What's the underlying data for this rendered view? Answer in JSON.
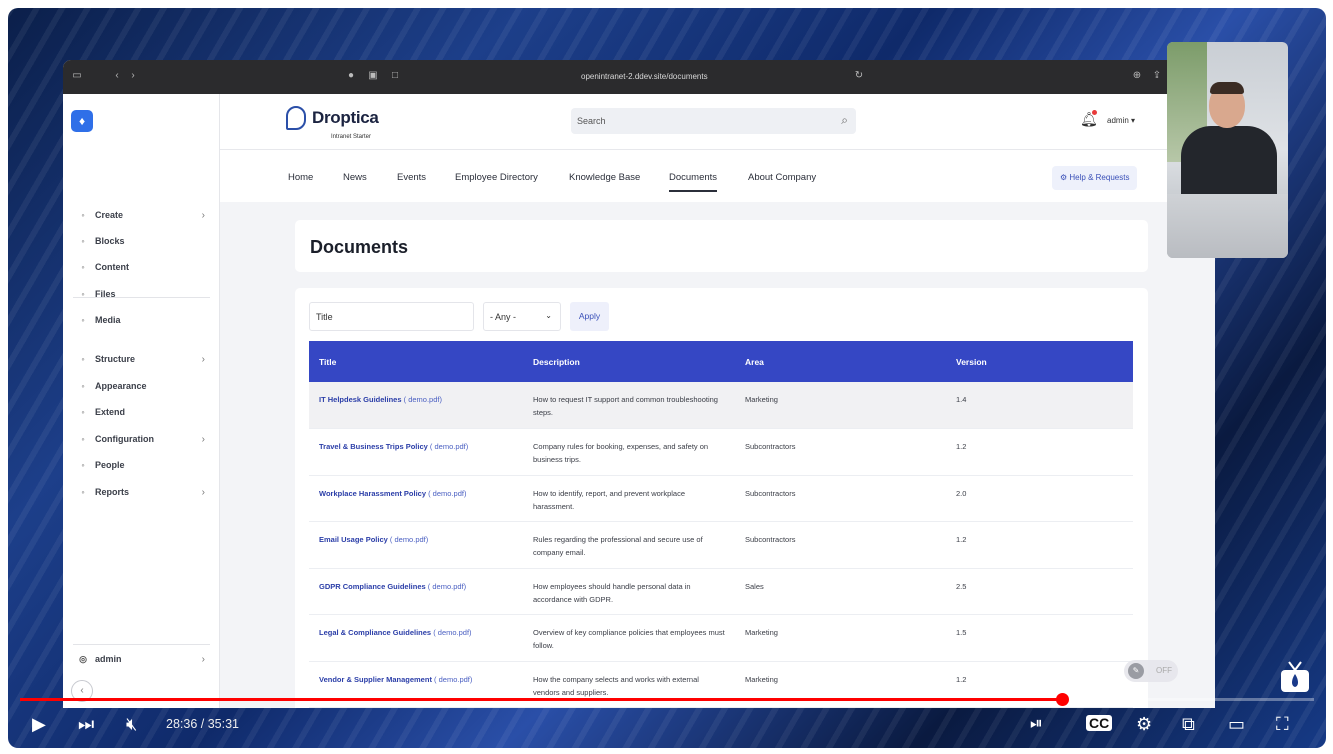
{
  "browser": {
    "url": "openintranet-2.ddev.site/documents"
  },
  "sidebar": {
    "items": [
      {
        "label": "Create",
        "icon": "plus-circle-icon",
        "chevron": true
      },
      {
        "label": "Blocks",
        "icon": "grid-icon",
        "chevron": false
      },
      {
        "label": "Content",
        "icon": "document-icon",
        "chevron": false
      },
      {
        "label": "Files",
        "icon": "file-icon",
        "chevron": false
      },
      {
        "label": "Media",
        "icon": "image-icon",
        "chevron": false
      },
      {
        "label": "Structure",
        "icon": "sitemap-icon",
        "chevron": true
      },
      {
        "label": "Appearance",
        "icon": "brush-icon",
        "chevron": false
      },
      {
        "label": "Extend",
        "icon": "puzzle-icon",
        "chevron": false
      },
      {
        "label": "Configuration",
        "icon": "sliders-icon",
        "chevron": true
      },
      {
        "label": "People",
        "icon": "people-icon",
        "chevron": false
      },
      {
        "label": "Reports",
        "icon": "gauge-icon",
        "chevron": true
      }
    ],
    "user": "admin"
  },
  "header": {
    "brand_name": "Droptica",
    "brand_sub": "Intranet Starter",
    "search_placeholder": "Search",
    "user": "admin"
  },
  "nav": {
    "items": [
      "Home",
      "News",
      "Events",
      "Employee Directory",
      "Knowledge Base",
      "Documents",
      "About Company"
    ],
    "active": "Documents",
    "help_button": "Help & Requests"
  },
  "page": {
    "title": "Documents",
    "filter_title_placeholder": "Title",
    "filter_area_value": "- Any -",
    "apply_label": "Apply"
  },
  "table": {
    "headers": [
      "Title",
      "Description",
      "Area",
      "Version"
    ],
    "rows": [
      {
        "title": "IT Helpdesk Guidelines",
        "file": "( demo.pdf)",
        "description": "How to request IT support and common troubleshooting steps.",
        "area": "Marketing",
        "version": "1.4"
      },
      {
        "title": "Travel & Business Trips Policy",
        "file": "( demo.pdf)",
        "description": "Company rules for booking, expenses, and safety on business trips.",
        "area": "Subcontractors",
        "version": "1.2"
      },
      {
        "title": "Workplace Harassment Policy",
        "file": "( demo.pdf)",
        "description": "How to identify, report, and prevent workplace harassment.",
        "area": "Subcontractors",
        "version": "2.0"
      },
      {
        "title": "Email Usage Policy",
        "file": "( demo.pdf)",
        "description": "Rules regarding the professional and secure use of company email.",
        "area": "Subcontractors",
        "version": "1.2"
      },
      {
        "title": "GDPR Compliance Guidelines",
        "file": "( demo.pdf)",
        "description": "How employees should handle personal data in accordance with GDPR.",
        "area": "Sales",
        "version": "2.5"
      },
      {
        "title": "Legal & Compliance Guidelines",
        "file": "( demo.pdf)",
        "description": "Overview of key compliance policies that employees must follow.",
        "area": "Marketing",
        "version": "1.5"
      },
      {
        "title": "Vendor & Supplier Management",
        "file": "( demo.pdf)",
        "description": "How the company selects and works with external vendors and suppliers.",
        "area": "Marketing",
        "version": "1.2"
      }
    ]
  },
  "toggle": {
    "label": "OFF"
  },
  "player": {
    "time": "28:36 / 35:31",
    "progress": 0.805,
    "accent": "#ff0000"
  }
}
